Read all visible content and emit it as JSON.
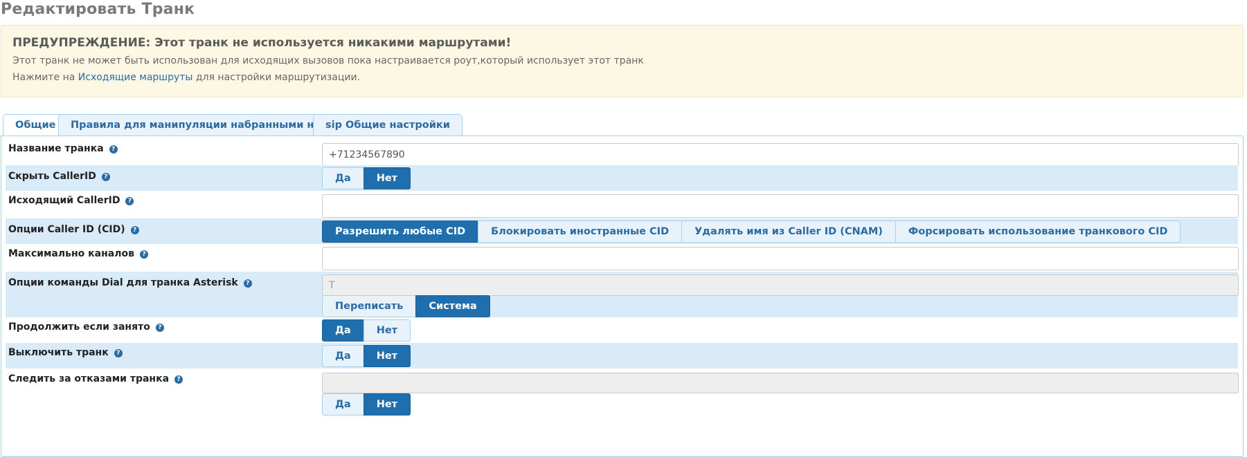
{
  "page": {
    "title": "Редактировать Транк"
  },
  "alert": {
    "title": "ПРЕДУПРЕЖДЕНИЕ: Этот транк не используется никакими маршрутами!",
    "line1": "Этот транк не может быть использован для исходящих вызовов пока настраивается роут,который использует этот транк",
    "line2_prefix": "Нажмите на ",
    "line2_link": "Исходящие маршруты",
    "line2_suffix": " для настройки маршрутизации."
  },
  "tabs": [
    {
      "label": "Общие",
      "active": true
    },
    {
      "label": "Правила для манипуляции набранными номерами",
      "active": false
    },
    {
      "label": "sip Общие настройки",
      "active": false
    }
  ],
  "help_glyph": "?",
  "form": {
    "trunk_name": {
      "label": "Название транка",
      "value": "+71234567890"
    },
    "hide_callerid": {
      "label": "Скрыть CallerID",
      "options": [
        "Да",
        "Нет"
      ],
      "selected": "Нет"
    },
    "outbound_callerid": {
      "label": "Исходящий CallerID",
      "value": ""
    },
    "cid_options": {
      "label": "Опции Caller ID (CID)",
      "options": [
        "Разрешить любые CID",
        "Блокировать иностранные CID",
        "Удалять имя из Caller ID (CNAM)",
        "Форсировать использование транкового CID"
      ],
      "selected": "Разрешить любые CID"
    },
    "max_channels": {
      "label": "Максимально каналов",
      "value": ""
    },
    "dial_options": {
      "label": "Опции команды Dial для транка Asterisk",
      "value": "T",
      "options": [
        "Переписать",
        "Система"
      ],
      "selected": "Система"
    },
    "continue_if_busy": {
      "label": "Продолжить если занято",
      "options": [
        "Да",
        "Нет"
      ],
      "selected": "Да"
    },
    "disable_trunk": {
      "label": "Выключить транк",
      "options": [
        "Да",
        "Нет"
      ],
      "selected": "Нет"
    },
    "monitor_failures": {
      "label": "Следить за отказами транка",
      "value": "",
      "options": [
        "Да",
        "Нет"
      ],
      "selected": "Нет"
    }
  },
  "colors": {
    "accent": "#1f6fae",
    "row_alt": "#d9eaf8",
    "alert_bg": "#fcf8e3"
  }
}
